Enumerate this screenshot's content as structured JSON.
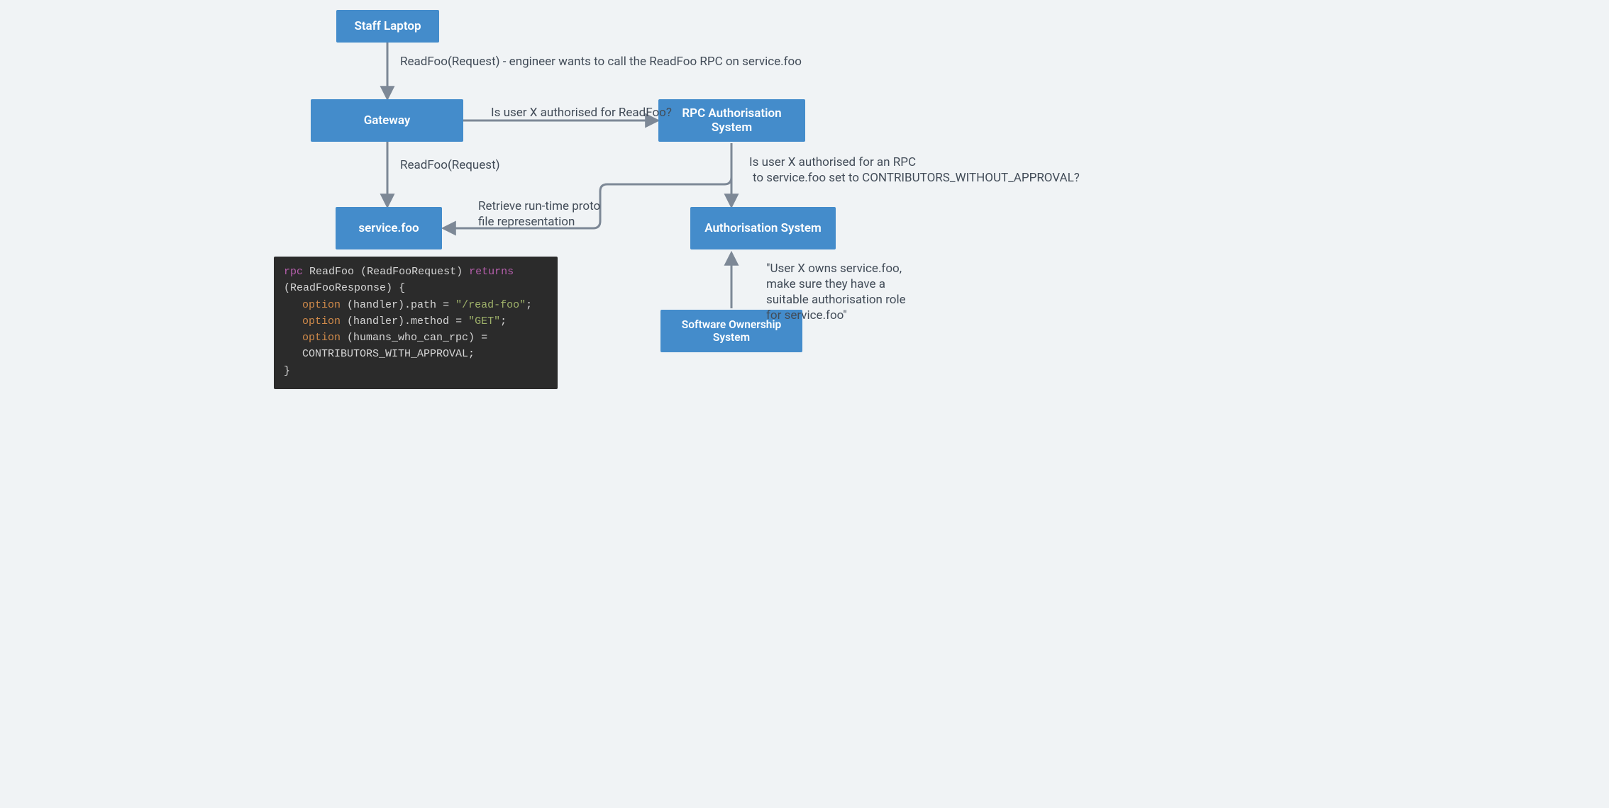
{
  "nodes": {
    "staff_laptop": "Staff Laptop",
    "gateway": "Gateway",
    "service_foo": "service.foo",
    "rpc_auth": "RPC Authorisation System",
    "auth": "Authorisation System",
    "ownership": "Software Ownership System"
  },
  "edges": {
    "laptop_to_gateway": "ReadFoo(Request) - engineer wants to call the ReadFoo RPC on service.foo",
    "gateway_to_rpcauth": "Is user X authorised for ReadFoo?",
    "gateway_to_service": "ReadFoo(Request)",
    "rpcauth_to_service_l1": "Retrieve run-time proto",
    "rpcauth_to_service_l2": "file representation",
    "rpcauth_to_auth_l1": "Is user X authorised for an RPC",
    "rpcauth_to_auth_l2": "to service.foo set to CONTRIBUTORS_WITHOUT_APPROVAL?",
    "ownership_to_auth_l1": "\"User X owns service.foo,",
    "ownership_to_auth_l2": "make sure they have a",
    "ownership_to_auth_l3": "suitable authorisation role",
    "ownership_to_auth_l4": "for service.foo\""
  },
  "code": {
    "kw_rpc": "rpc",
    "id_readfoo": "ReadFoo",
    "id_req": "ReadFooRequest",
    "kw_returns": "returns",
    "id_resp": "ReadFooResponse",
    "brace_open": "{",
    "brace_close": "}",
    "kw_option": "option",
    "handler_path": "(handler).path",
    "handler_method": "(handler).method",
    "humans": "(humans_who_can_rpc)",
    "eq": "=",
    "semi": ";",
    "str_path": "\"/read-foo\"",
    "str_method": "\"GET\"",
    "val_humans": "CONTRIBUTORS_WITH_APPROVAL"
  },
  "colors": {
    "node_bg": "#448ccb",
    "page_bg": "#f0f3f5",
    "arrow": "#7d8896",
    "text": "#424c58",
    "code_bg": "#2b2b2b"
  }
}
